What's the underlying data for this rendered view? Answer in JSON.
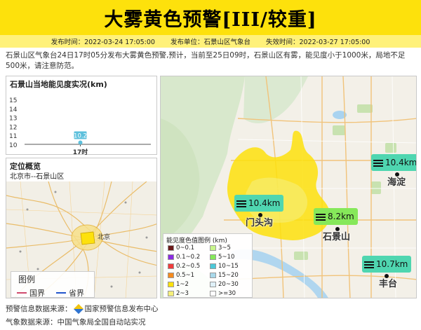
{
  "title": "大雾黄色预警[III/较重]",
  "meta": {
    "publish_time": "发布时间：2022-03-24 17:05:00",
    "publisher": "发布单位：石景山区气象台",
    "expire_time": "失效时间：2022-03-27 17:05:00"
  },
  "description": "石景山区气象台24日17时05分发布大雾黄色预警,预计，当前至25日09时，石景山区有雾，能见度小于1000米，局地不足500米，请注意防范。",
  "chart_panel": {
    "title": "石景山当地能见度实况(km)"
  },
  "chart_data": {
    "type": "scatter",
    "title": "石景山当地能见度实况(km)",
    "categories": [
      "17时"
    ],
    "values": [
      10.2
    ],
    "value_labels": [
      "10.2"
    ],
    "y_ticks": [
      "15",
      "14",
      "13",
      "12",
      "11",
      "10"
    ],
    "ylim": [
      10,
      15
    ],
    "xlabel": "",
    "ylabel": "",
    "grid": false,
    "color": "#5dc0dc"
  },
  "location": {
    "title": "定位概览",
    "subtitle": "北京市--石景山区",
    "city_label": "北京",
    "legend_title": "图例",
    "legend_items": [
      {
        "label": "国界",
        "color": "#d04b6e"
      },
      {
        "label": "省界",
        "color": "#2255cc"
      }
    ]
  },
  "visibility_legend": {
    "title": "能见度色值图例 (km)",
    "items": [
      {
        "label": "0~0.1",
        "color": "#6b1a1a"
      },
      {
        "label": "3~5",
        "color": "#c8f58c"
      },
      {
        "label": "0.1~0.2",
        "color": "#8a2be2"
      },
      {
        "label": "5~10",
        "color": "#86e85a"
      },
      {
        "label": "0.2~0.5",
        "color": "#f03c3c"
      },
      {
        "label": "10~15",
        "color": "#4cc8d8"
      },
      {
        "label": "0.5~1",
        "color": "#f58b1e"
      },
      {
        "label": "15~20",
        "color": "#a8d8ea"
      },
      {
        "label": "1~2",
        "color": "#fde10c"
      },
      {
        "label": "20~30",
        "color": "#dff0f8"
      },
      {
        "label": "2~3",
        "color": "#f5ef7a"
      },
      {
        "label": ">=30",
        "color": "#ffffff"
      }
    ]
  },
  "stations": [
    {
      "name": "海淀",
      "value": "10.4km",
      "color": "#4fd6b0"
    },
    {
      "name": "门头沟",
      "value": "10.4km",
      "color": "#4fd6b0"
    },
    {
      "name": "石景山",
      "value": "8.2km",
      "color": "#86e85a"
    },
    {
      "name": "丰台",
      "value": "10.7km",
      "color": "#4fd6b0"
    }
  ],
  "sources": {
    "warning": "预警信息数据来源：",
    "warning_org": "国家预警信息发布中心",
    "weather": "气象数据来源：中国气象局全国自动站实况"
  }
}
